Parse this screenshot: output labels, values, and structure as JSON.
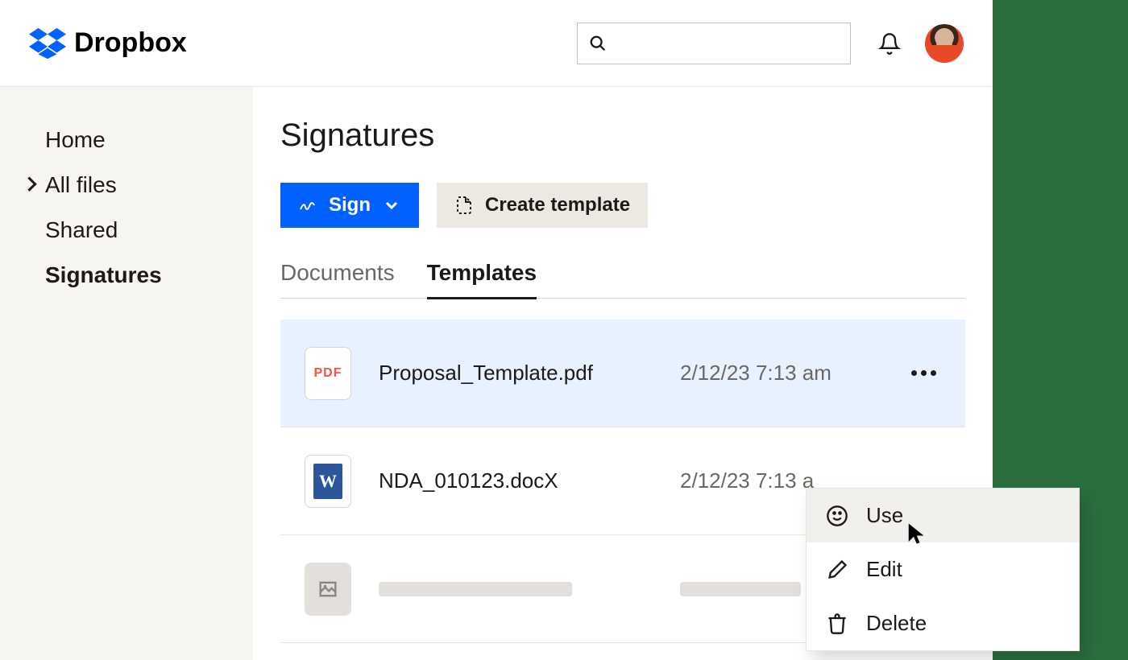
{
  "brand": "Dropbox",
  "sidebar": {
    "items": [
      {
        "label": "Home",
        "expandable": false,
        "active": false
      },
      {
        "label": "All files",
        "expandable": true,
        "active": false
      },
      {
        "label": "Shared",
        "expandable": false,
        "active": false
      },
      {
        "label": "Signatures",
        "expandable": false,
        "active": true
      }
    ]
  },
  "page": {
    "title": "Signatures",
    "sign_button": "Sign",
    "create_template_button": "Create template"
  },
  "tabs": [
    {
      "label": "Documents",
      "active": false
    },
    {
      "label": "Templates",
      "active": true
    }
  ],
  "rows": [
    {
      "icon": "pdf",
      "icon_label": "PDF",
      "name": "Proposal_Template.pdf",
      "date": "2/12/23 7:13 am",
      "selected": true
    },
    {
      "icon": "docx",
      "icon_label": "",
      "name": "NDA_010123.docX",
      "date": "2/12/23 7:13 a",
      "selected": false
    },
    {
      "icon": "placeholder",
      "icon_label": "",
      "name": "",
      "date": "",
      "selected": false
    }
  ],
  "context_menu": {
    "items": [
      {
        "label": "Use",
        "icon": "smile",
        "hover": true
      },
      {
        "label": "Edit",
        "icon": "pencil",
        "hover": false
      },
      {
        "label": "Delete",
        "icon": "trash",
        "hover": false
      }
    ]
  },
  "colors": {
    "accent": "#0061fe",
    "background_right": "#2a6e3f"
  }
}
